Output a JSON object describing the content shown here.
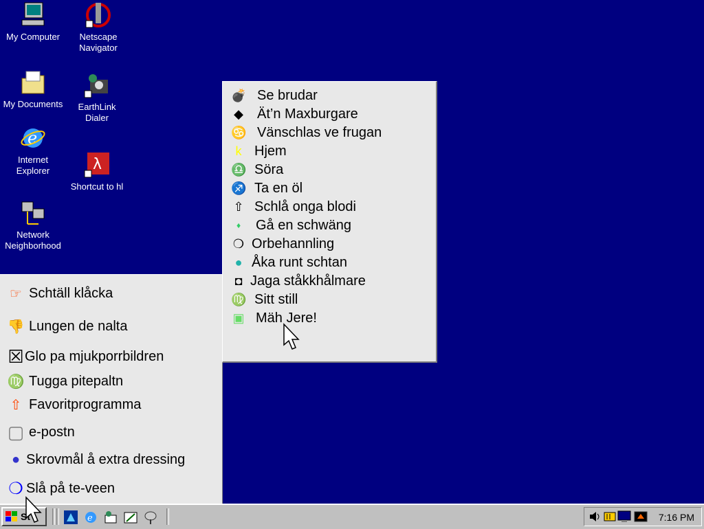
{
  "desktop": {
    "icons": [
      {
        "label": "My Computer",
        "icon": "my-computer-icon"
      },
      {
        "label": "Netscape\nNavigator",
        "icon": "netscape-navigator-icon"
      },
      {
        "label": "My Documents",
        "icon": "my-documents-icon"
      },
      {
        "label": "EarthLink\nDialer",
        "icon": "earthlink-dialer-icon"
      },
      {
        "label": "Internet\nExplorer",
        "icon": "internet-explorer-icon"
      },
      {
        "label": "Shortcut to hl",
        "icon": "shortcut-icon"
      },
      {
        "label": "Network\nNeighborhood",
        "icon": "network-neighborhood-icon"
      }
    ]
  },
  "start_menu": {
    "items": [
      {
        "label": "Schtäll klåcka",
        "glyph": "☞",
        "color": "#ff4500"
      },
      {
        "label": "Lungen de nalta",
        "glyph": "👎",
        "color": "#2e8b57"
      },
      {
        "label": "Glo pa mjukporrbildren",
        "glyph": "☒",
        "color": "#000000"
      },
      {
        "label": "Tugga pitepaltn",
        "glyph": "♍",
        "color": "#ffff00"
      },
      {
        "label": "Favoritprogramma",
        "glyph": "⇧",
        "color": "#ff4500"
      },
      {
        "label": "e-postn",
        "glyph": "▢",
        "color": "#808080"
      },
      {
        "label": "Skrovmål å extra dressing",
        "glyph": "●",
        "color": "#3333cc"
      },
      {
        "label": "Slå på te-veen",
        "glyph": "❍",
        "color": "#0000ff"
      }
    ]
  },
  "popup_menu": {
    "items": [
      {
        "label": "Se brudar",
        "glyph": "💣",
        "color": "#20b2aa"
      },
      {
        "label": "Ät’n Maxburgare",
        "glyph": "◆",
        "color": "#000000"
      },
      {
        "label": "Vänschlas ve frugan",
        "glyph": "♋",
        "color": "#000000"
      },
      {
        "label": "Hjem",
        "glyph": "k",
        "color": "#ffff00"
      },
      {
        "label": "Söra",
        "glyph": "♎",
        "color": "#66dd66"
      },
      {
        "label": "Ta en öl",
        "glyph": "♐",
        "color": "#3333cc"
      },
      {
        "label": "Schlå onga blodi",
        "glyph": "⇧",
        "color": "#000000"
      },
      {
        "label": "Gå en schwäng",
        "glyph": "♦",
        "color": "#33cc66"
      },
      {
        "label": "Orbehannling",
        "glyph": "❍",
        "color": "#000000"
      },
      {
        "label": "Åka runt schtan",
        "glyph": "●",
        "color": "#20b2aa"
      },
      {
        "label": "Jaga ståkkhålmare",
        "glyph": "◘",
        "color": "#000000"
      },
      {
        "label": "Sitt still",
        "glyph": "♍",
        "color": "#ff4500"
      },
      {
        "label": "Mäh Jere!",
        "glyph": "▣",
        "color": "#66dd66"
      }
    ]
  },
  "taskbar": {
    "start_label": "St",
    "clock": "7:16 PM"
  },
  "colors": {
    "desktop": "#000080",
    "menu_bg": "#e8e8e8",
    "taskbar": "#c0c0c0"
  }
}
